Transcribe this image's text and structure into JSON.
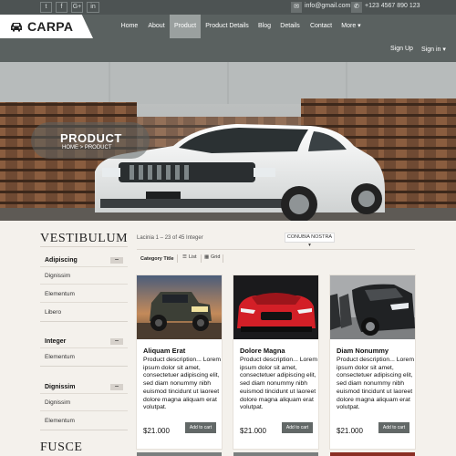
{
  "topbar": {
    "social_icons": [
      "twitter-icon",
      "facebook-icon",
      "google-plus-icon",
      "linkedin-icon"
    ],
    "social_glyphs": [
      "t",
      "f",
      "G+",
      "in"
    ],
    "email": "info@gmail.com",
    "phone": "+123 4567 890 123"
  },
  "brand": {
    "name": "CARPA",
    "icon": "car-icon"
  },
  "nav": {
    "items": [
      {
        "label": "Home",
        "active": false
      },
      {
        "label": "About",
        "active": false
      },
      {
        "label": "Product",
        "active": true
      },
      {
        "label": "Product Details",
        "active": false
      },
      {
        "label": "Blog",
        "active": false
      },
      {
        "label": "Details",
        "active": false
      },
      {
        "label": "Contact",
        "active": false
      },
      {
        "label": "More ▾",
        "active": false
      }
    ],
    "sign_up": "Sign Up",
    "sign_in": "Sign in ▾"
  },
  "hero": {
    "title": "PRODUCT",
    "breadcrumb": "HOME > PRODUCT"
  },
  "sidebar": {
    "title": "VESTIBULUM",
    "groups": [
      {
        "title": "Adipiscing",
        "toggle": "−",
        "items": [
          "Dignissim",
          "Elementum",
          "Libero"
        ]
      },
      {
        "title": "Integer",
        "toggle": "−",
        "items": [
          "Elementum"
        ]
      },
      {
        "title": "Dignissim",
        "toggle": "−",
        "items": [
          "Dignissim",
          "Elementum"
        ]
      }
    ],
    "bottom_title": "FUSCE"
  },
  "toolbar": {
    "results": "Lacinia 1 – 23 of 45 Integer",
    "sort": "CONUBIA NOSTRA ▾",
    "category_title": "Category Title",
    "list_label": "List",
    "grid_label": "Grid"
  },
  "products": [
    {
      "title": "Aliquam Erat",
      "description": "Product description... Lorem ipsum dolor sit amet, consectetuer adipiscing elit, sed diam nonummy nibh euismod tincidunt ut laoreet dolore magna aliquam erat volutpat.",
      "price": "$21.000",
      "button": "Add to cart"
    },
    {
      "title": "Dolore Magna",
      "description": "Product description... Lorem ipsum dolor sit amet, consectetuer adipiscing elit, sed diam nonummy nibh euismod tincidunt ut laoreet dolore magna aliquam erat volutpat.",
      "price": "$21.000",
      "button": "Add to cart"
    },
    {
      "title": "Diam Nonummy",
      "description": "Product description... Lorem ipsum dolor sit amet, consectetuer adipiscing elit, sed diam nonummy nibh euismod tincidunt ut laoreet dolore magna aliquam erat volutpat.",
      "price": "$21.000",
      "button": "Add to cart"
    }
  ],
  "colors": {
    "topbar": "#4d5353",
    "navbar": "#5a6160",
    "active_nav": "#9aa09f",
    "button": "#626867",
    "page_background": "#f4f1ec"
  }
}
